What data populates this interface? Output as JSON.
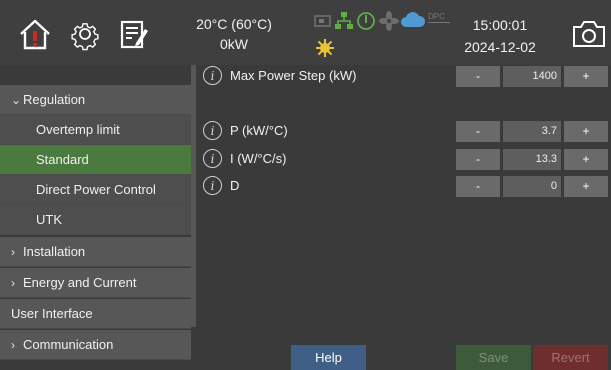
{
  "header": {
    "temperature": "20°C (60°C)",
    "power": "0kW",
    "time": "15:00:01",
    "date": "2024-12-02",
    "status_text": "DPC",
    "icons": [
      "home-alert-icon",
      "settings-gear-icon",
      "notepad-icon",
      "plug-icon",
      "network-icon",
      "power-icon",
      "fan-icon",
      "cloud-icon",
      "dpc-icon",
      "sun-icon",
      "camera-icon"
    ]
  },
  "menu": {
    "items": [
      {
        "label": "Regulation",
        "expanded": true
      },
      {
        "label": "Overtemp limit"
      },
      {
        "label": "Standard",
        "active": true
      },
      {
        "label": "Direct Power Control"
      },
      {
        "label": "UTK"
      },
      {
        "label": "Installation",
        "expanded": false
      },
      {
        "label": "Energy and Current",
        "expanded": false
      },
      {
        "label": "User Interface"
      },
      {
        "label": "Communication",
        "expanded": false
      }
    ]
  },
  "params": [
    {
      "info": "i",
      "label": "Max Power Step (kW)",
      "minus": "-",
      "value": "1400",
      "plus": "+"
    },
    {
      "info": "i",
      "label": "P (kW/°C)",
      "minus": "-",
      "value": "3.7",
      "plus": "+"
    },
    {
      "info": "i",
      "label": "I (W/°C/s)",
      "minus": "-",
      "value": "13.3",
      "plus": "+"
    },
    {
      "info": "i",
      "label": "D",
      "minus": "-",
      "value": "0",
      "plus": "+"
    }
  ],
  "footer": {
    "help": "Help",
    "save": "Save",
    "revert": "Revert"
  },
  "colors": {
    "active": "#4b7a3f",
    "help": "#3f5f86",
    "save": "#3d5a3a",
    "revert": "#6e2e2e",
    "status_green": "#5fae48",
    "status_blue": "#4f9ad3",
    "sun": "#e8c33a"
  }
}
